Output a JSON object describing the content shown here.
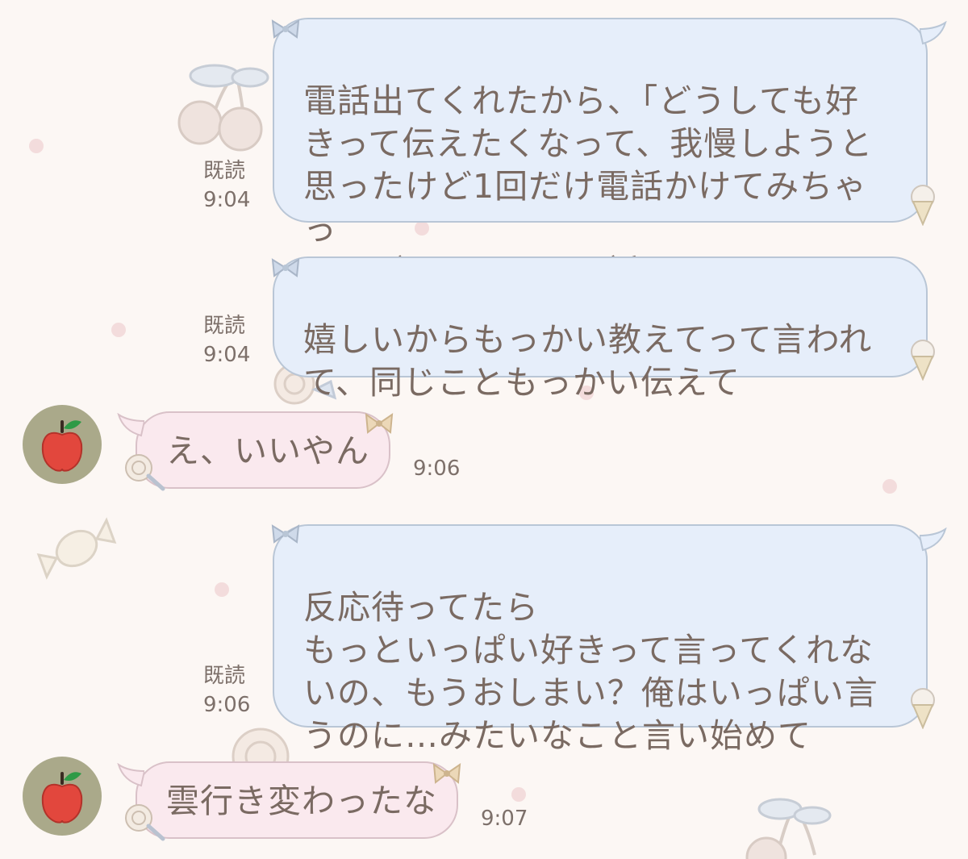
{
  "messages": [
    {
      "id": 1,
      "side": "out",
      "text": "電話出てくれたから、「どうしても好\nきって伝えたくなって、我慢しようと\n思ったけど1回だけ電話かけてみちゃっ\nた。ごめんね」って話したら",
      "read_label": "既読",
      "time": "9:04"
    },
    {
      "id": 2,
      "side": "out",
      "text": "嬉しいからもっかい教えてって言われ\nて、同じこともっかい伝えて",
      "read_label": "既読",
      "time": "9:04"
    },
    {
      "id": 3,
      "side": "in",
      "text": "え、いいやん",
      "time": "9:06"
    },
    {
      "id": 4,
      "side": "out",
      "text": "反応待ってたら\nもっといっぱい好きって言ってくれな\nいの、もうおしまい？俺はいっぱい言\nうのに…みたいなこと言い始めて",
      "read_label": "既読",
      "time": "9:06"
    },
    {
      "id": 5,
      "side": "in",
      "text": "雲行き変わったな",
      "time": "9:07"
    }
  ],
  "colors": {
    "background": "#fcf7f4",
    "out_bubble": "#e6eefa",
    "out_border": "#b9c6d6",
    "in_bubble": "#fae9ee",
    "in_border": "#d9c1c8",
    "text": "#7a6a62",
    "avatar_bg": "#aaa98a",
    "apple": "#e2473d"
  },
  "icons": [
    "cherry-icon",
    "candy-icon",
    "lollipop-icon",
    "ice-cream-icon",
    "bow-icon",
    "apple-avatar-icon"
  ]
}
